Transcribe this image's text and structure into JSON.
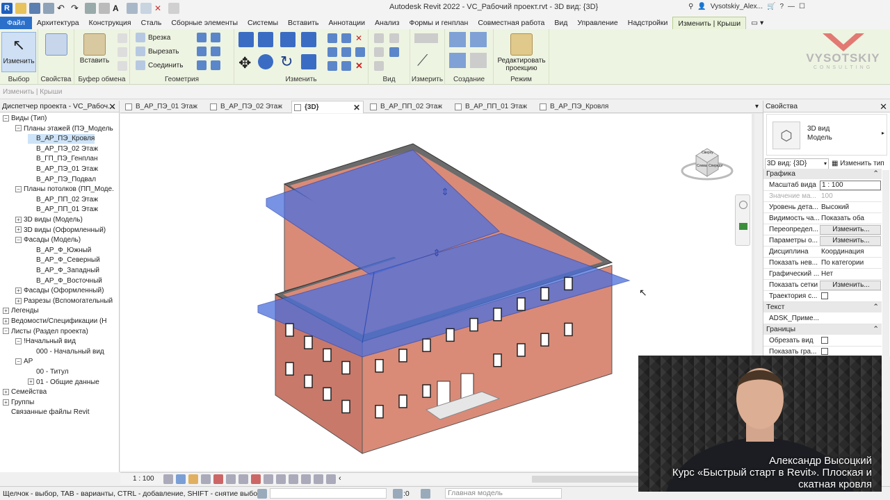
{
  "app": {
    "title": "Autodesk Revit 2022 - VC_Рабочий проект.rvt - 3D вид: {3D}",
    "user": "Vysotskiy_Alex..."
  },
  "menu": {
    "tabs": [
      "Файл",
      "Архитектура",
      "Конструкция",
      "Сталь",
      "Сборные элементы",
      "Системы",
      "Вставить",
      "Аннотации",
      "Анализ",
      "Формы и генплан",
      "Совместная работа",
      "Вид",
      "Управление",
      "Надстройки",
      "Изменить | Крыши"
    ]
  },
  "ribbon": {
    "modify_label": "Изменить",
    "paste_label": "Вставить",
    "cut_label": "Врезка",
    "cutout_label": "Вырезать",
    "join_label": "Соединить",
    "edit_proj_label": "Редактировать проекцию",
    "groups": {
      "select": "Выбор",
      "props": "Свойства",
      "clipboard": "Буфер обмена",
      "geometry": "Геометрия",
      "modify": "Изменить",
      "view": "Вид",
      "measure": "Измерить",
      "create": "Создание",
      "mode": "Режим"
    },
    "watermark": "VYSOTSKIY",
    "watermark_sub": "CONSULTING"
  },
  "optionsbar": {
    "text": "Изменить | Крыши"
  },
  "browser": {
    "title": "Диспетчер проекта - VC_Рабоч...",
    "items": [
      {
        "label": "Виды (Тип)",
        "level": 0,
        "tog": "-"
      },
      {
        "label": "Планы этажей (ПЭ_Модель",
        "level": 1,
        "tog": "-"
      },
      {
        "label": "В_АР_ПЭ_Кровля",
        "level": 2,
        "tog": "",
        "sel": true
      },
      {
        "label": "В_АР_ПЭ_02 Этаж",
        "level": 2,
        "tog": ""
      },
      {
        "label": "В_ГП_ПЭ_Генплан",
        "level": 2,
        "tog": ""
      },
      {
        "label": "В_АР_ПЭ_01 Этаж",
        "level": 2,
        "tog": ""
      },
      {
        "label": "В_АР_ПЭ_Подвал",
        "level": 2,
        "tog": ""
      },
      {
        "label": "Планы потолков (ПП_Моде.",
        "level": 1,
        "tog": "-"
      },
      {
        "label": "В_АР_ПП_02 Этаж",
        "level": 2,
        "tog": ""
      },
      {
        "label": "В_АР_ПП_01 Этаж",
        "level": 2,
        "tog": ""
      },
      {
        "label": "3D виды (Модель)",
        "level": 1,
        "tog": "+"
      },
      {
        "label": "3D виды (Оформленный)",
        "level": 1,
        "tog": "+"
      },
      {
        "label": "Фасады (Модель)",
        "level": 1,
        "tog": "-"
      },
      {
        "label": "В_АР_Ф_Южный",
        "level": 2,
        "tog": ""
      },
      {
        "label": "В_АР_Ф_Северный",
        "level": 2,
        "tog": ""
      },
      {
        "label": "В_АР_Ф_Западный",
        "level": 2,
        "tog": ""
      },
      {
        "label": "В_АР_Ф_Восточный",
        "level": 2,
        "tog": ""
      },
      {
        "label": "Фасады (Оформленный)",
        "level": 1,
        "tog": "+"
      },
      {
        "label": "Разрезы (Вспомогательный",
        "level": 1,
        "tog": "+"
      },
      {
        "label": "Легенды",
        "level": 0,
        "tog": "+"
      },
      {
        "label": "Ведомости/Спецификации (Н",
        "level": 0,
        "tog": "+"
      },
      {
        "label": "Листы (Раздел проекта)",
        "level": 0,
        "tog": "-"
      },
      {
        "label": "!Начальный вид",
        "level": 1,
        "tog": "-"
      },
      {
        "label": "000 - Начальный вид",
        "level": 2,
        "tog": ""
      },
      {
        "label": "АР",
        "level": 1,
        "tog": "-"
      },
      {
        "label": "00 - Титул",
        "level": 2,
        "tog": ""
      },
      {
        "label": "01 - Общие данные",
        "level": 2,
        "tog": "+"
      },
      {
        "label": "Семейства",
        "level": 0,
        "tog": "+"
      },
      {
        "label": "Группы",
        "level": 0,
        "tog": "+"
      },
      {
        "label": "Связанные файлы Revit",
        "level": 0,
        "tog": ""
      }
    ]
  },
  "viewtabs": [
    {
      "label": "В_АР_ПЭ_01 Этаж"
    },
    {
      "label": "В_АР_ПЭ_02 Этаж"
    },
    {
      "label": "{3D}",
      "active": true
    },
    {
      "label": "В_АР_ПП_02 Этаж"
    },
    {
      "label": "В_АР_ПП_01 Этаж"
    },
    {
      "label": "В_АР_ПЭ_Кровля"
    }
  ],
  "viewcube": {
    "top": "Сверху",
    "left": "Слева",
    "front": "Спереди"
  },
  "viewctl": {
    "scale": "1 : 100"
  },
  "status": {
    "hint": "Щелчок - выбор, TAB - варианты, CTRL - добавление, SHIFT - снятие выбора.",
    "count": ":0",
    "model": "Главная модель"
  },
  "properties": {
    "title": "Свойства",
    "type_name": "3D вид",
    "type_sub": "Модель",
    "selector": "3D вид: {3D}",
    "edit_type": "Изменить тип",
    "groups": {
      "graphics": "Графика",
      "text": "Текст",
      "bounds": "Границы"
    },
    "rows": [
      {
        "k": "Масштаб вида",
        "v": "1 : 100",
        "kind": "input"
      },
      {
        "k": "Значение ма...",
        "v": "100",
        "kind": "grey"
      },
      {
        "k": "Уровень дета...",
        "v": "Высокий"
      },
      {
        "k": "Видимость ча...",
        "v": "Показать оба"
      },
      {
        "k": "Переопредел...",
        "v": "Изменить...",
        "kind": "btn"
      },
      {
        "k": "Параметры о...",
        "v": "Изменить...",
        "kind": "btn"
      },
      {
        "k": "Дисциплина",
        "v": "Координация"
      },
      {
        "k": "Показать нев...",
        "v": "По категории"
      },
      {
        "k": "Графический ...",
        "v": "Нет"
      },
      {
        "k": "Показать сетки",
        "v": "Изменить...",
        "kind": "btn"
      },
      {
        "k": "Траектория с...",
        "v": "",
        "kind": "chk"
      }
    ],
    "text_rows": [
      {
        "k": "ADSK_Приме...",
        "v": ""
      }
    ],
    "bound_rows": [
      {
        "k": "Обрезать вид",
        "v": "",
        "kind": "chk"
      },
      {
        "k": "Показать гра...",
        "v": "",
        "kind": "chk"
      }
    ]
  },
  "webcam": {
    "caption1": "Александр Высоцкий",
    "caption2": "Курс «Быстрый старт в Revit». Плоская и скатная кровля"
  },
  "colors": {
    "accent": "#2a6fc9",
    "ribbon": "#eef4e2",
    "wall": "#d98b78",
    "roof": "#4c6fdc"
  }
}
